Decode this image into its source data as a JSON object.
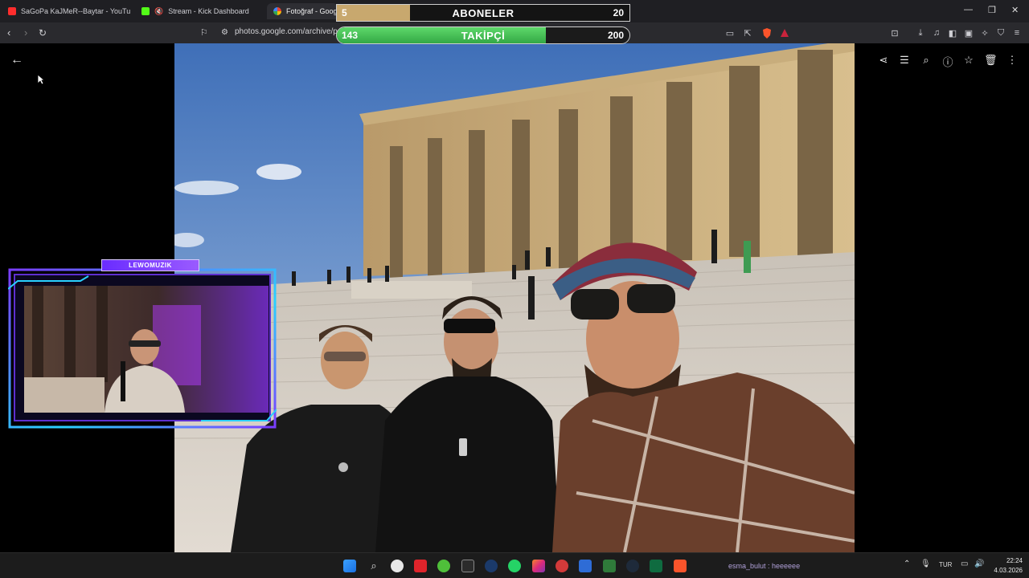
{
  "tabs": [
    {
      "label": "SaGoPa KaJMeR--Baytar - YouTube"
    },
    {
      "label": "Stream - Kick Dashboard"
    },
    {
      "label": "Fotoğraf - Google"
    }
  ],
  "address": {
    "url": "photos.google.com/archive/p"
  },
  "overlay": {
    "subs": {
      "label": "ABONELER",
      "current": "5",
      "goal": "20",
      "progress": 0.25
    },
    "followers": {
      "label": "TAKİPÇİ",
      "current": "143",
      "goal": "200",
      "progress": 0.715
    }
  },
  "webcam": {
    "tag": "LEWOMUZIK"
  },
  "taskbar": {
    "chat": "esma_bulut : heeeeee",
    "language": "TUR",
    "time": "22:24",
    "date": "4.03.2026"
  },
  "colors": {
    "subs_fill": "#c8a86e",
    "followers_fill": "#3fbf52",
    "cam_accent": "#7a3cff"
  }
}
